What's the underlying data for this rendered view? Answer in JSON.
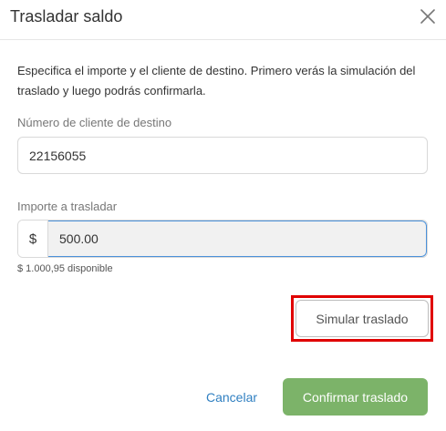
{
  "dialog": {
    "title": "Trasladar saldo",
    "close_icon": "close-icon"
  },
  "description": "Especifica el importe y el cliente de destino. Primero verás la simulación del traslado y luego podrás confirmarla.",
  "client_field": {
    "label": "Número de cliente de destino",
    "value": "22156055"
  },
  "amount_field": {
    "label": "Importe a trasladar",
    "currency_symbol": "$",
    "value": "500.00",
    "available": "$ 1.000,95 disponible"
  },
  "actions": {
    "simulate_label": "Simular traslado",
    "cancel_label": "Cancelar",
    "confirm_label": "Confirmar traslado"
  },
  "colors": {
    "confirm_button": "#7cb369",
    "cancel_link": "#2f7fc1",
    "highlight": "#e00000",
    "focus_border": "#4a90d9"
  }
}
